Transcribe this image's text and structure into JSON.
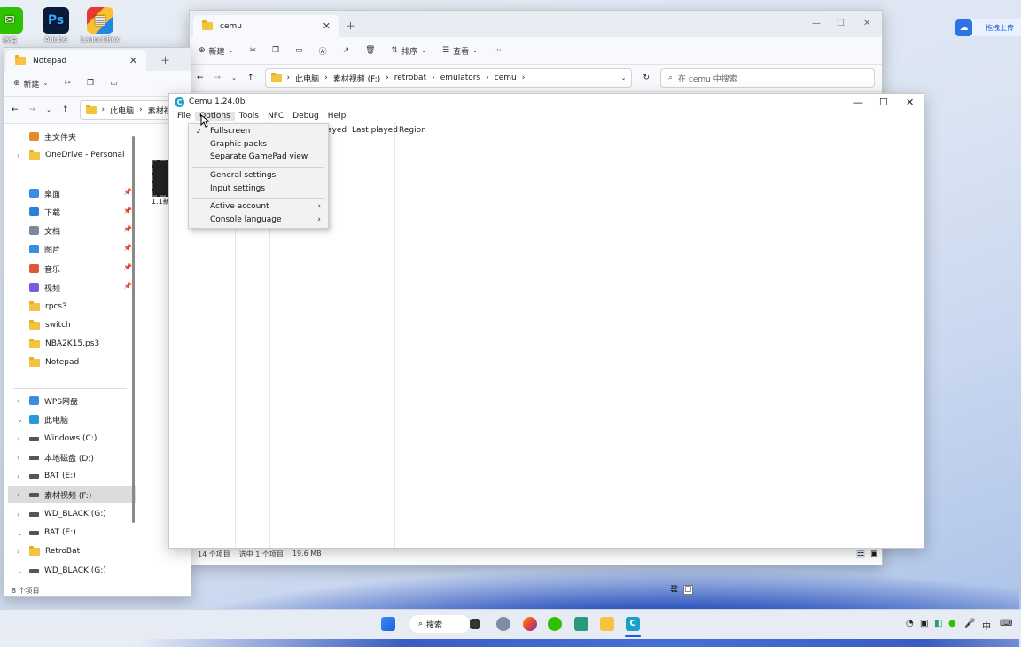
{
  "desktop": {
    "icons": [
      {
        "label": "微信",
        "color": "#2dc100",
        "glyph": "✉"
      },
      {
        "label": "Adobe",
        "color": "#0a1a3a",
        "glyph": "Ps"
      },
      {
        "label": "LaunchBox",
        "color": "#ffffff",
        "glyph": "▦"
      }
    ]
  },
  "cloud_upload": {
    "label": "拖拽上传"
  },
  "explorer_back": {
    "tab_title": "cemu",
    "toolbar": {
      "new_label": "新建",
      "sort_label": "排序",
      "view_label": "查看",
      "more": "···"
    },
    "breadcrumb": [
      "此电脑",
      "素材视频 (F:)",
      "retrobat",
      "emulators",
      "cemu"
    ],
    "search_placeholder": "在 cemu 中搜索",
    "status": {
      "items": "14 个项目",
      "selected": "选中 1 个项目",
      "size": "19.6 MB"
    }
  },
  "explorer_notepad": {
    "tab_title": "Notepad",
    "toolbar": {
      "new_label": "新建"
    },
    "breadcrumb": [
      "此电脑",
      "素材视"
    ],
    "file_label": "1.1新",
    "nav": [
      {
        "label": "主文件夹",
        "icon": "home-icon",
        "chev": "",
        "pin": false
      },
      {
        "label": "OneDrive - Personal",
        "icon": "folder-icon",
        "chev": "›",
        "pin": false
      },
      {
        "label": "桌面",
        "icon": "desktop-icon",
        "chev": "",
        "pin": true
      },
      {
        "label": "下载",
        "icon": "download-icon",
        "chev": "",
        "pin": true
      },
      {
        "label": "文档",
        "icon": "document-icon",
        "chev": "",
        "pin": true
      },
      {
        "label": "图片",
        "icon": "picture-icon",
        "chev": "",
        "pin": true
      },
      {
        "label": "音乐",
        "icon": "music-icon",
        "chev": "",
        "pin": true
      },
      {
        "label": "视频",
        "icon": "video-icon",
        "chev": "",
        "pin": true
      },
      {
        "label": "rpcs3",
        "icon": "folder-icon",
        "chev": "",
        "pin": false
      },
      {
        "label": "switch",
        "icon": "folder-icon",
        "chev": "",
        "pin": false
      },
      {
        "label": "NBA2K15.ps3",
        "icon": "folder-icon",
        "chev": "",
        "pin": false
      },
      {
        "label": "Notepad",
        "icon": "folder-icon",
        "chev": "",
        "pin": false
      },
      {
        "label": "WPS网盘",
        "icon": "cloud-icon",
        "chev": "›",
        "pin": false
      },
      {
        "label": "此电脑",
        "icon": "pc-icon",
        "chev": "⌄",
        "pin": false
      },
      {
        "label": "Windows (C:)",
        "icon": "drive-icon",
        "chev": "›",
        "pin": false
      },
      {
        "label": "本地磁盘 (D:)",
        "icon": "drive-icon",
        "chev": "›",
        "pin": false
      },
      {
        "label": "BAT (E:)",
        "icon": "drive-icon",
        "chev": "›",
        "pin": false
      },
      {
        "label": "素材视频 (F:)",
        "icon": "drive-icon",
        "chev": "›",
        "pin": false,
        "selected": true
      },
      {
        "label": "WD_BLACK (G:)",
        "icon": "drive-icon",
        "chev": "›",
        "pin": false
      },
      {
        "label": "BAT (E:)",
        "icon": "drive-icon",
        "chev": "⌄",
        "pin": false
      },
      {
        "label": "RetroBat",
        "icon": "folder-icon",
        "chev": "›",
        "pin": false
      },
      {
        "label": "WD_BLACK (G:)",
        "icon": "drive-icon",
        "chev": "⌄",
        "pin": false
      }
    ],
    "status": {
      "items": "8 个项目"
    }
  },
  "cemu": {
    "title": "Cemu 1.24.0b",
    "menu": [
      "File",
      "Options",
      "Tools",
      "NFC",
      "Debug",
      "Help"
    ],
    "columns_visible": [
      "ayed",
      "Last played",
      "Region"
    ],
    "options_menu": {
      "items": [
        {
          "label": "Fullscreen",
          "checked": true,
          "submenu": false
        },
        {
          "label": "Graphic packs",
          "checked": false,
          "submenu": false
        },
        {
          "label": "Separate GamePad view",
          "checked": false,
          "submenu": false
        },
        {
          "label": "General settings",
          "checked": false,
          "submenu": false
        },
        {
          "label": "Input settings",
          "checked": false,
          "submenu": false
        },
        {
          "label": "Active account",
          "checked": false,
          "submenu": true
        },
        {
          "label": "Console language",
          "checked": false,
          "submenu": true
        }
      ]
    }
  },
  "taskbar": {
    "search_label": "搜索",
    "ime_label": "中"
  }
}
